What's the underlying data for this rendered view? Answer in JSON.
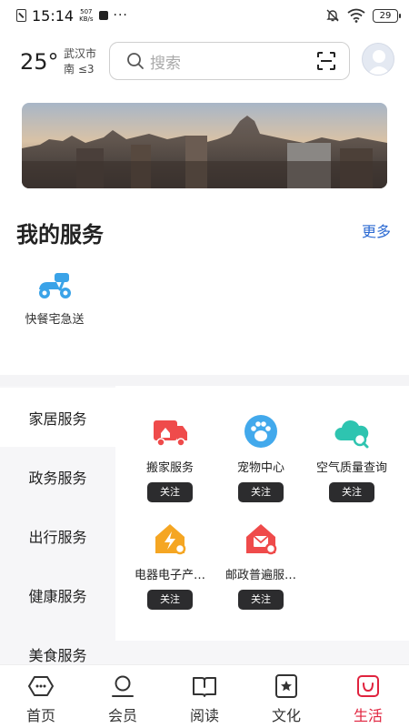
{
  "status_bar": {
    "time": "15:14",
    "speed_value": "507",
    "speed_unit": "KB/s",
    "more": "···",
    "battery": "29"
  },
  "header": {
    "temperature": "25°",
    "city": "武汉市",
    "wind": "南 ≤3",
    "search_placeholder": "搜索"
  },
  "my_services": {
    "title": "我的服务",
    "more": "更多",
    "items": [
      {
        "label": "快餐宅急送",
        "icon": "scooter-icon"
      }
    ]
  },
  "categories": [
    {
      "label": "家居服务",
      "active": true
    },
    {
      "label": "政务服务",
      "active": false
    },
    {
      "label": "出行服务",
      "active": false
    },
    {
      "label": "健康服务",
      "active": false
    },
    {
      "label": "美食服务",
      "active": false
    }
  ],
  "services": [
    {
      "name": "搬家服务",
      "follow": "关注",
      "icon": "moving-truck-icon",
      "color": "#ef4b4b"
    },
    {
      "name": "宠物中心",
      "follow": "关注",
      "icon": "paw-icon",
      "color": "#42a9ec"
    },
    {
      "name": "空气质量查询",
      "follow": "关注",
      "icon": "cloud-search-icon",
      "color": "#2ec4b0"
    },
    {
      "name": "电器电子产…",
      "follow": "关注",
      "icon": "lightning-house-icon",
      "color": "#f5a623"
    },
    {
      "name": "邮政普遍服…",
      "follow": "关注",
      "icon": "mail-house-icon",
      "color": "#ef4b4b"
    }
  ],
  "tab_bar": [
    {
      "label": "首页",
      "icon": "home-icon",
      "active": false
    },
    {
      "label": "会员",
      "icon": "member-icon",
      "active": false
    },
    {
      "label": "阅读",
      "icon": "book-icon",
      "active": false
    },
    {
      "label": "文化",
      "icon": "star-card-icon",
      "active": false
    },
    {
      "label": "生活",
      "icon": "life-bag-icon",
      "active": true
    }
  ],
  "colors": {
    "accent_blue": "#2c6ad2",
    "active_red": "#e0233e",
    "follow_button": "#2c2c2e"
  }
}
